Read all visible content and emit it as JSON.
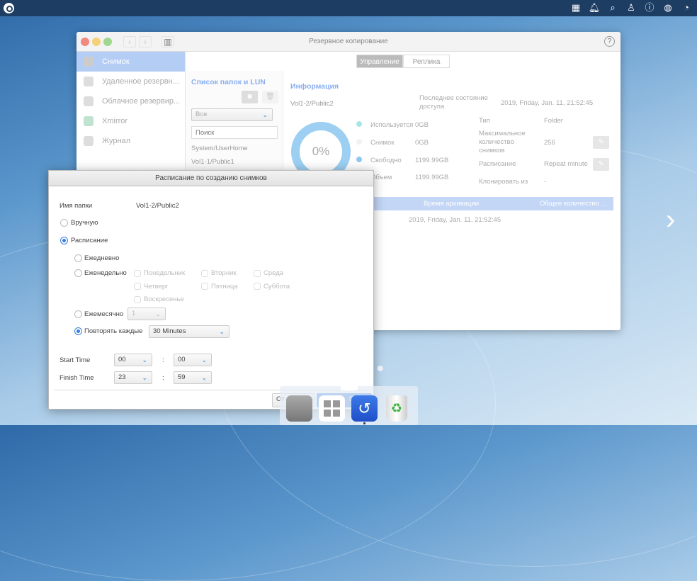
{
  "window": {
    "title": "Резервное копирование",
    "tabs": [
      {
        "label": "Управление",
        "active": true
      },
      {
        "label": "Реплика",
        "active": false
      }
    ]
  },
  "sidebar": {
    "items": [
      {
        "label": "Снимок",
        "active": true
      },
      {
        "label": "Удаленное резервн..."
      },
      {
        "label": "Облачное резервир..."
      },
      {
        "label": "Xmirror"
      },
      {
        "label": "Журнал"
      }
    ]
  },
  "folders": {
    "title": "Список папок и LUN",
    "filter": "Все",
    "search_placeholder": "Поиск",
    "items": [
      "System/UserHome",
      "Vol1-1/Public1"
    ]
  },
  "info": {
    "title": "Информация",
    "folder": "Vol1-2/Public2",
    "usage_percent": "0%",
    "legend": [
      {
        "label": "Используется",
        "value": "0GB",
        "color": "#a8e6e6"
      },
      {
        "label": "Снимок",
        "value": "0GB",
        "color": "#f2f2f2"
      },
      {
        "label": "Свободно",
        "value": "1199.99GB",
        "color": "#8fc8f0"
      },
      {
        "label": "Объем",
        "value": "1199.99GB"
      }
    ],
    "last_access_label": "Последнее состояние доступа",
    "last_access": "2019, Friday, Jan. 11, 21:52:45",
    "type_label": "Тип",
    "type": "Folder",
    "max_label": "Максимальное количество снимков",
    "max": "256",
    "schedule_label": "Расписание",
    "schedule": "Repeat minute",
    "clone_label": "Клонировать из",
    "clone": "-"
  },
  "table": {
    "columns": [
      "Время архивации",
      "Общее количество ..."
    ],
    "rows": [
      [
        "2019, Friday, Jan. 11, 21:52:45",
        ""
      ]
    ]
  },
  "dialog": {
    "title": "Расписание по созданию снимков",
    "folder_label": "Имя папки",
    "folder": "Vol1-2/Public2",
    "manual": "Вручную",
    "schedule": "Расписание",
    "daily": "Ежедневно",
    "weekly": "Еженедельно",
    "days": [
      "Понедельник",
      "Вторник",
      "Среда",
      "Четверг",
      "Пятница",
      "Суббота",
      "Воскресенье"
    ],
    "monthly": "Ежемесячно",
    "monthly_value": "1",
    "repeat": "Повторять каждые",
    "repeat_value": "30 Minutes",
    "start_label": "Start Time",
    "start_h": "00",
    "start_m": "00",
    "finish_label": "Finish Time",
    "finish_h": "23",
    "finish_m": "59",
    "colon": ":",
    "cancel": "От",
    "apply": "Пр"
  },
  "colors": {
    "topbar": "#1e3d63",
    "accent": "#3a7de0",
    "sidebar_active": "#b4cdf5"
  }
}
